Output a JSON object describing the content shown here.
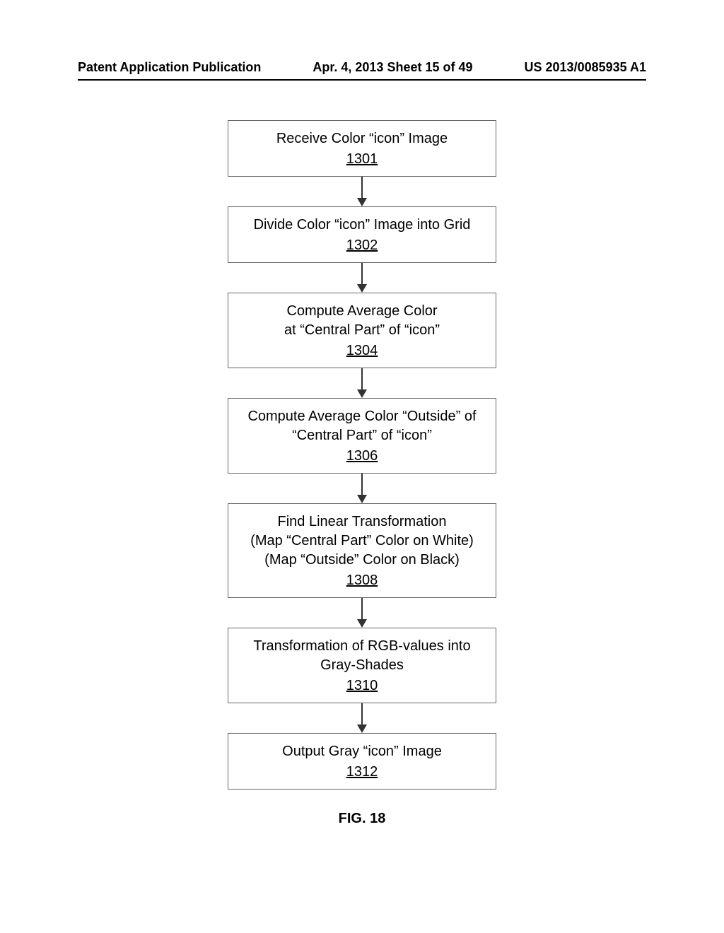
{
  "header": {
    "left": "Patent Application Publication",
    "center": "Apr. 4, 2013  Sheet 15 of 49",
    "right": "US 2013/0085935 A1"
  },
  "steps": [
    {
      "lines": [
        "Receive Color “icon” Image"
      ],
      "ref": "1301"
    },
    {
      "lines": [
        "Divide Color “icon” Image into Grid"
      ],
      "ref": "1302"
    },
    {
      "lines": [
        "Compute Average Color",
        "at “Central Part” of “icon”"
      ],
      "ref": "1304"
    },
    {
      "lines": [
        "Compute Average Color “Outside” of",
        "“Central Part” of “icon”"
      ],
      "ref": "1306"
    },
    {
      "lines": [
        "Find Linear Transformation",
        "(Map “Central Part” Color on White)",
        "(Map “Outside” Color on Black)"
      ],
      "ref": "1308"
    },
    {
      "lines": [
        "Transformation of RGB-values into",
        "Gray-Shades"
      ],
      "ref": "1310"
    },
    {
      "lines": [
        "Output Gray “icon” Image"
      ],
      "ref": "1312"
    }
  ],
  "figure_label": "FIG. 18"
}
